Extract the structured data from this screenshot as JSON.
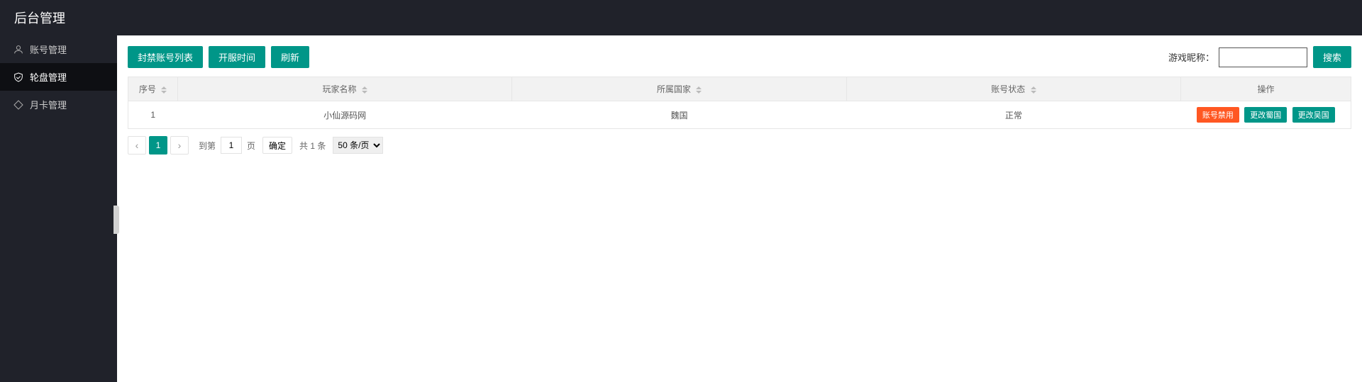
{
  "header": {
    "title": "后台管理"
  },
  "sidebar": {
    "items": [
      {
        "label": "账号管理"
      },
      {
        "label": "轮盘管理"
      },
      {
        "label": "月卡管理"
      }
    ]
  },
  "toolbar": {
    "banned_list_label": "封禁账号列表",
    "server_time_label": "开服时间",
    "refresh_label": "刷新",
    "search_label": "游戏昵称：",
    "search_value": "",
    "search_btn": "搜索"
  },
  "table": {
    "headers": {
      "seq": "序号",
      "name": "玩家名称",
      "country": "所属国家",
      "status": "账号状态",
      "ops": "操作"
    },
    "rows": [
      {
        "seq": "1",
        "name": "小仙源码网",
        "country": "魏国",
        "status": "正常",
        "op_ban": "账号禁用",
        "op_to_shu": "更改蜀国",
        "op_to_wu": "更改吴国"
      }
    ]
  },
  "pagination": {
    "current": "1",
    "goto_label": "到第",
    "goto_value": "1",
    "page_suffix": "页",
    "confirm_label": "确定",
    "total_label": "共 1 条",
    "size_label": "50 条/页"
  }
}
